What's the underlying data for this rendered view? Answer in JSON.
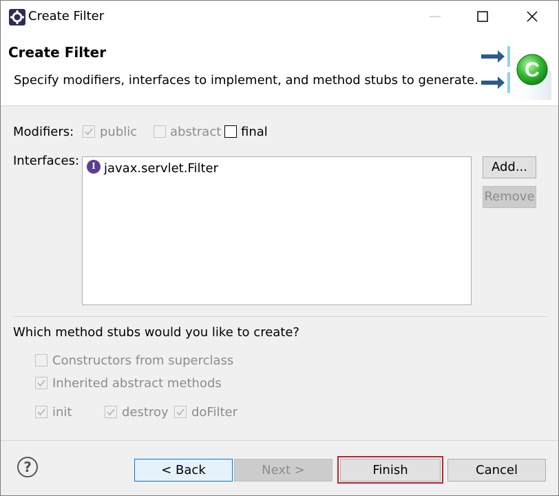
{
  "window": {
    "title": "Create Filter",
    "controls": {
      "minimize": "minimize-icon",
      "maximize": "maximize-icon",
      "close": "close-icon"
    }
  },
  "banner": {
    "title": "Create Filter",
    "description": "Specify modifiers, interfaces to implement, and method stubs to generate."
  },
  "modifiers": {
    "label": "Modifiers:",
    "public": {
      "label": "public",
      "checked": true,
      "enabled": false
    },
    "abstract": {
      "label": "abstract",
      "checked": false,
      "enabled": false
    },
    "final": {
      "label": "final",
      "checked": false,
      "enabled": true
    }
  },
  "interfaces": {
    "label": "Interfaces:",
    "items": [
      "javax.servlet.Filter"
    ],
    "add_label": "Add...",
    "remove_label": "Remove"
  },
  "stubs": {
    "question": "Which method stubs would you like to create?",
    "constructors": {
      "label": "Constructors from superclass",
      "checked": false
    },
    "inherited": {
      "label": "Inherited abstract methods",
      "checked": true
    },
    "init": {
      "label": "init",
      "checked": true
    },
    "destroy": {
      "label": "destroy",
      "checked": true
    },
    "dofilter": {
      "label": "doFilter",
      "checked": true
    }
  },
  "footer": {
    "help_glyph": "?",
    "back_label": "< Back",
    "next_label": "Next >",
    "finish_label": "Finish",
    "cancel_label": "Cancel"
  },
  "colors": {
    "highlight": "#c0202b",
    "focus": "#0078d7",
    "interface_icon": "#5c3f8f",
    "class_icon": "#2eb82e"
  }
}
